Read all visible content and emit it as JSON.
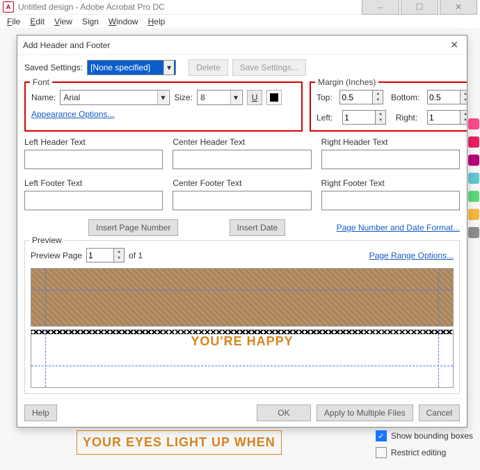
{
  "app": {
    "title": "Untitled design - Adobe Acrobat Pro DC",
    "icon_letter": "A"
  },
  "menu": {
    "file": "File",
    "edit": "Edit",
    "view": "View",
    "sign": "Sign",
    "window": "Window",
    "help": "Help"
  },
  "dialog": {
    "title": "Add Header and Footer",
    "saved": {
      "label": "Saved Settings:",
      "value": "[None specified]",
      "delete": "Delete",
      "save": "Save Settings..."
    },
    "font": {
      "legend": "Font",
      "name_label": "Name:",
      "name_value": "Arial",
      "size_label": "Size:",
      "size_value": "8",
      "underline_glyph": "U",
      "appearance_link": "Appearance Options..."
    },
    "margin": {
      "legend": "Margin (Inches)",
      "top_label": "Top:",
      "top_value": "0.5",
      "bottom_label": "Bottom:",
      "bottom_value": "0.5",
      "left_label": "Left:",
      "left_value": "1",
      "right_label": "Right:",
      "right_value": "1"
    },
    "text": {
      "lh": "Left Header Text",
      "ch": "Center Header Text",
      "rh": "Right Header Text",
      "lf": "Left Footer Text",
      "cf": "Center Footer Text",
      "rf": "Right Footer Text"
    },
    "mid": {
      "insert_page": "Insert Page Number",
      "insert_date": "Insert Date",
      "format_link": "Page Number and Date Format..."
    },
    "preview": {
      "legend": "Preview",
      "page_label": "Preview Page",
      "page_value": "1",
      "of_label": "of 1",
      "range_link": "Page Range Options...",
      "happy_text": "YOU'RE HAPPY"
    },
    "footer": {
      "help": "Help",
      "ok": "OK",
      "apply_multi": "Apply to Multiple Files",
      "cancel": "Cancel"
    }
  },
  "bg": {
    "eyes_text": "YOUR EYES LIGHT UP WHEN",
    "show_bb": "Show bounding boxes",
    "restrict": "Restrict editing"
  }
}
